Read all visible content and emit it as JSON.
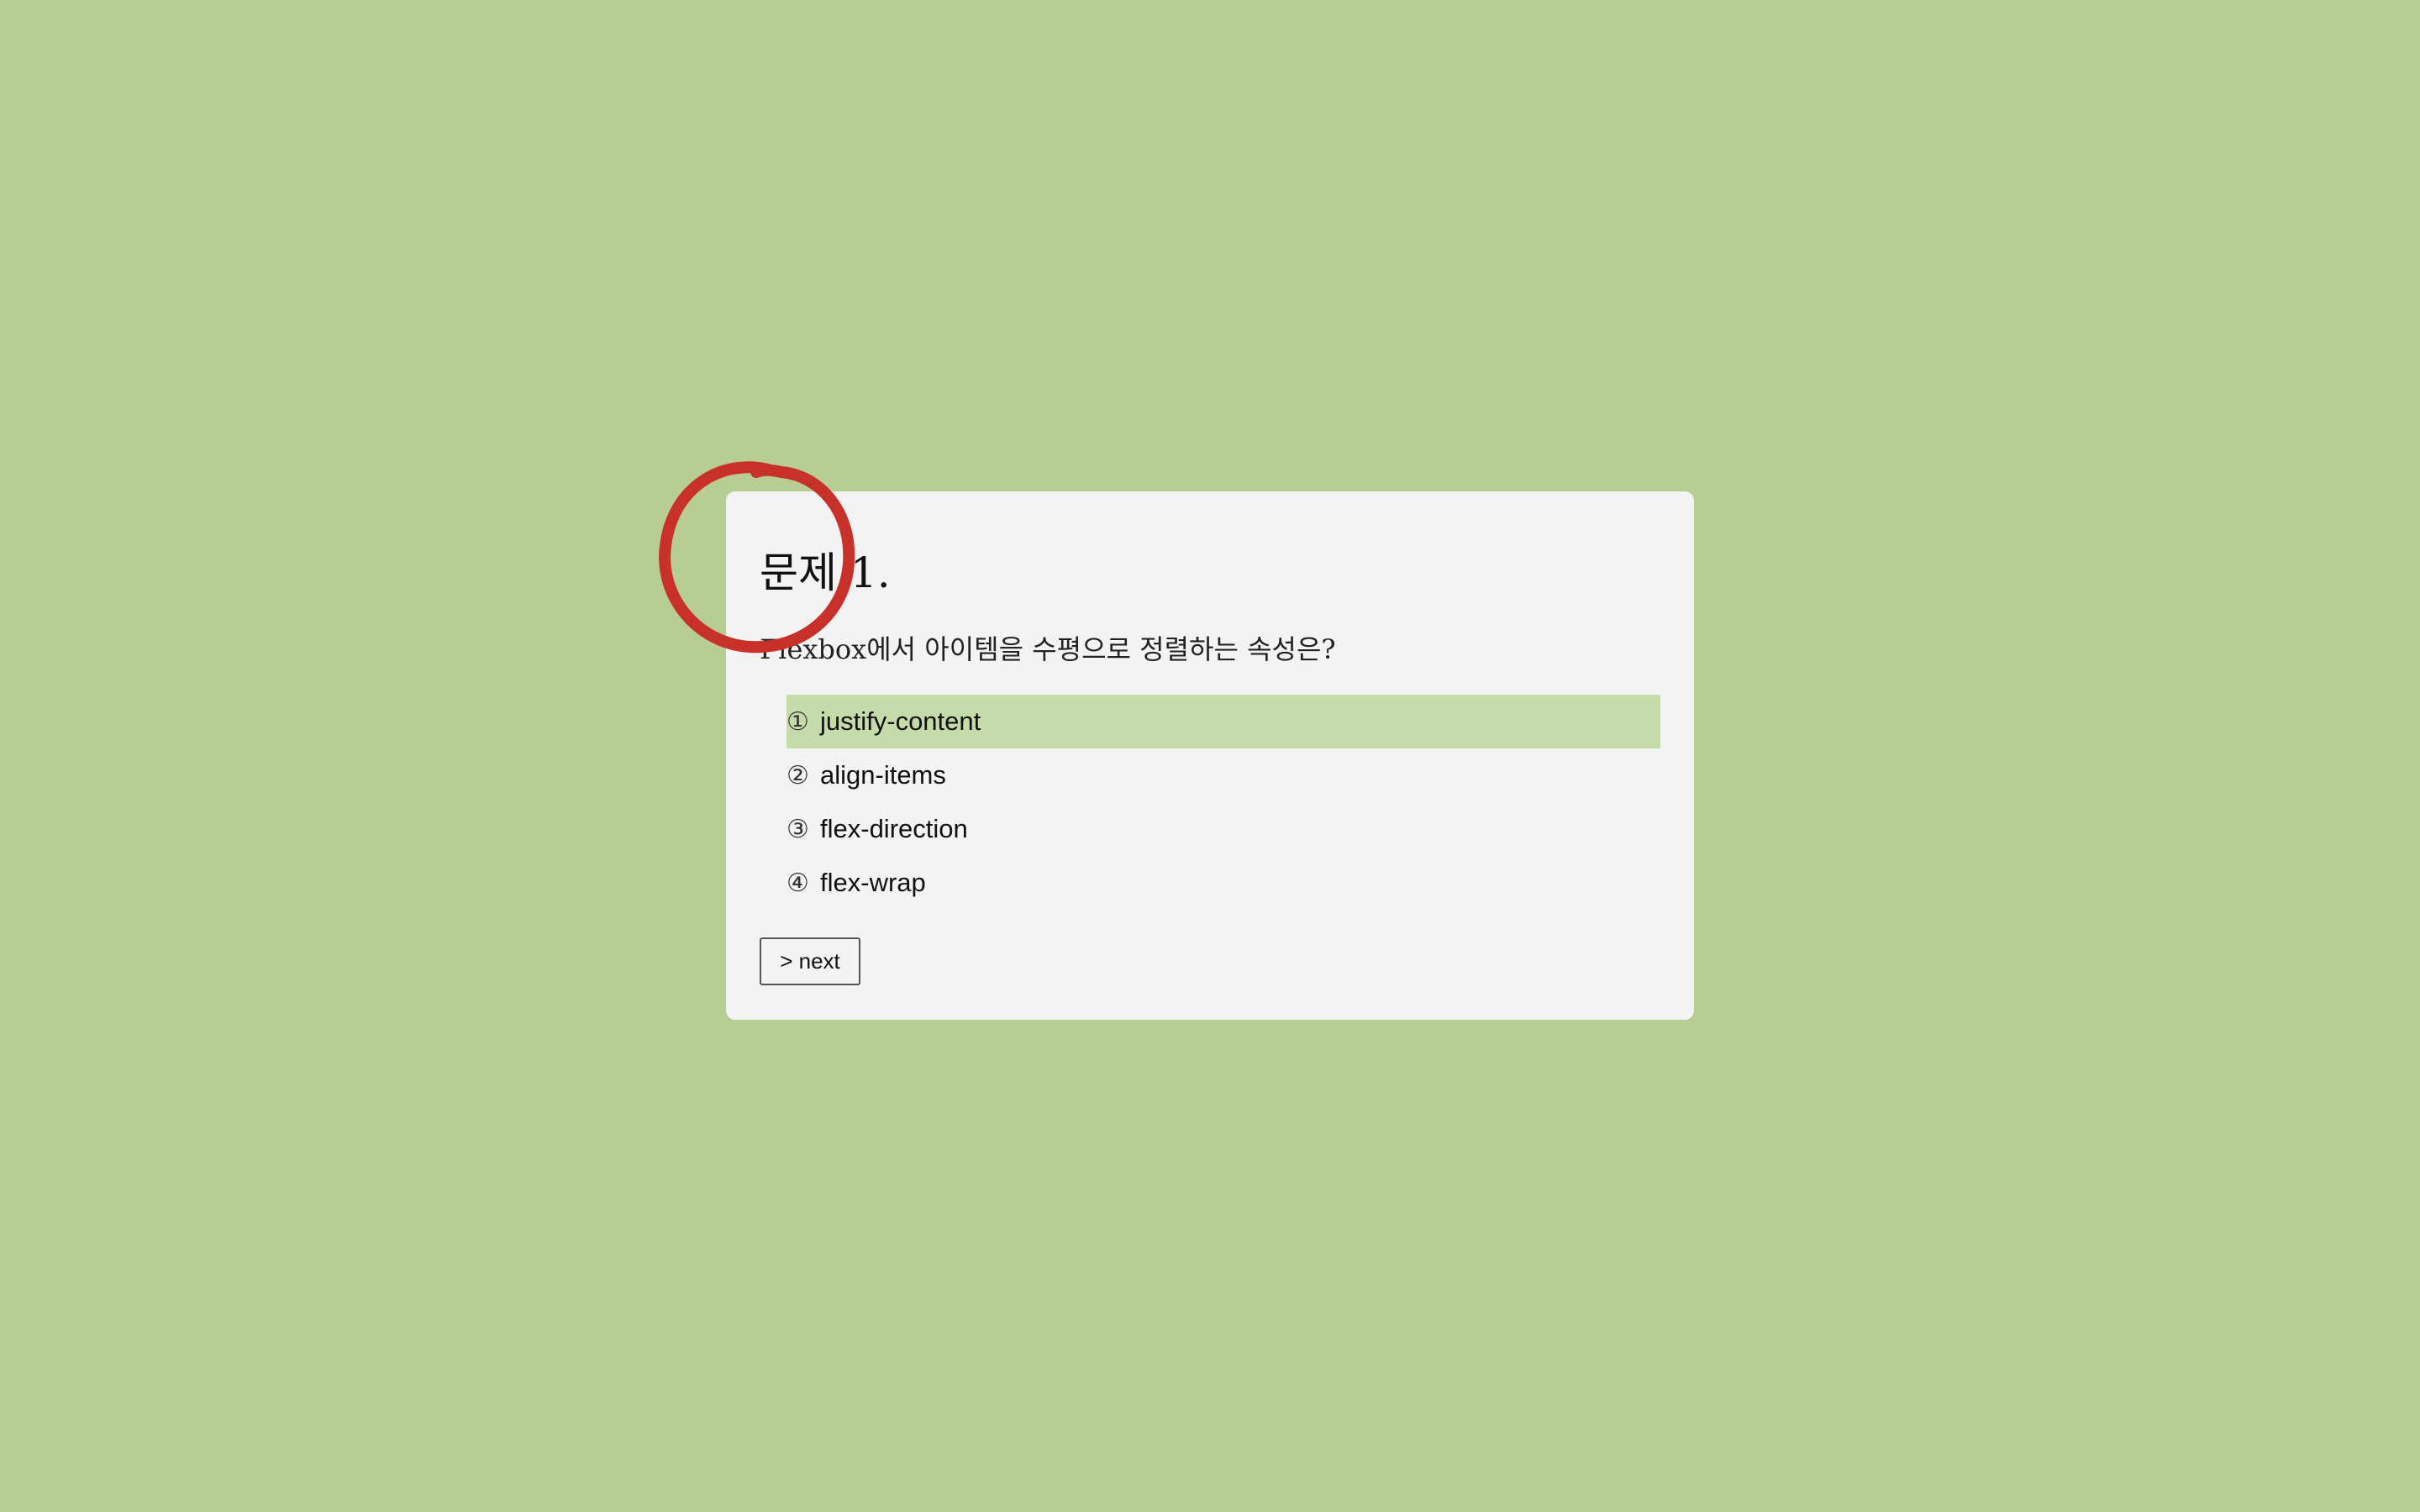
{
  "quiz": {
    "title": "문제 1.",
    "question": "Flexbox에서 아이템을 수평으로 정렬하는 속성은?",
    "options": [
      {
        "number": "①",
        "label": "justify-content",
        "selected": true
      },
      {
        "number": "②",
        "label": "align-items",
        "selected": false
      },
      {
        "number": "③",
        "label": "flex-direction",
        "selected": false
      },
      {
        "number": "④",
        "label": "flex-wrap",
        "selected": false
      }
    ],
    "next_label": "> next"
  },
  "colors": {
    "background": "#b8cd94",
    "card": "#f3f3f3",
    "selected_option": "#c6dbaa",
    "marker": "#c8302a"
  },
  "icons": {
    "marker": "red-circle-annotation"
  }
}
